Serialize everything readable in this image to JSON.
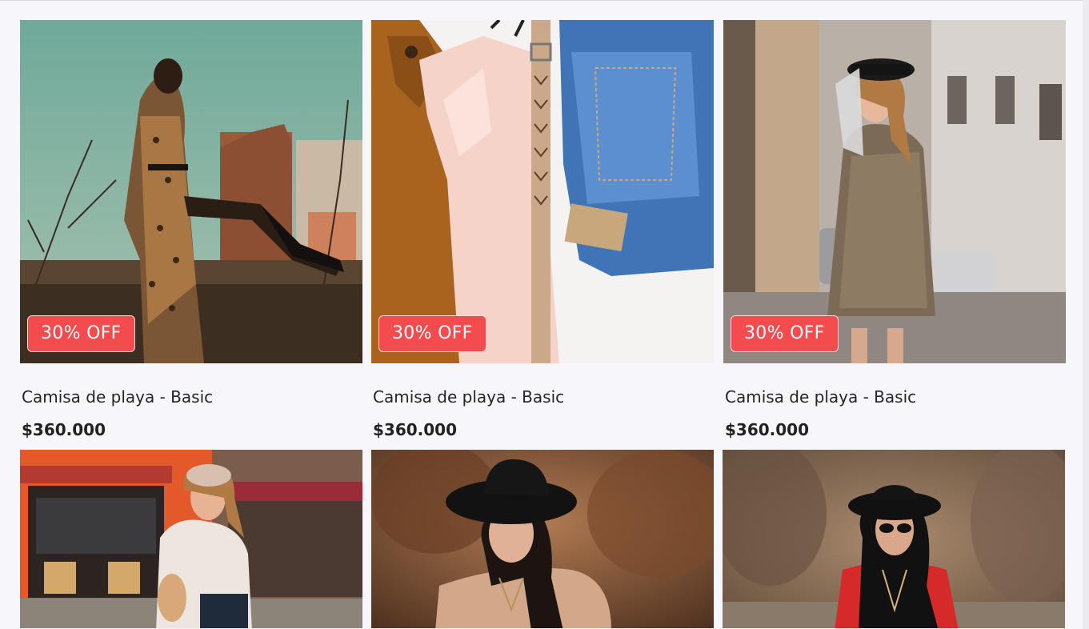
{
  "products": [
    {
      "name": "Camisa de playa - Basic",
      "price": "$360.000",
      "badge": "30% OFF"
    },
    {
      "name": "Camisa de playa - Basic",
      "price": "$360.000",
      "badge": "30% OFF"
    },
    {
      "name": "Camisa de playa - Basic",
      "price": "$360.000",
      "badge": "30% OFF"
    },
    {
      "name": "",
      "price": "",
      "badge": ""
    },
    {
      "name": "",
      "price": "",
      "badge": ""
    },
    {
      "name": "",
      "price": "",
      "badge": ""
    }
  ],
  "colors": {
    "badge_bg": "#f44b4f",
    "page_bg": "#f7f6fb",
    "text": "#252525"
  }
}
